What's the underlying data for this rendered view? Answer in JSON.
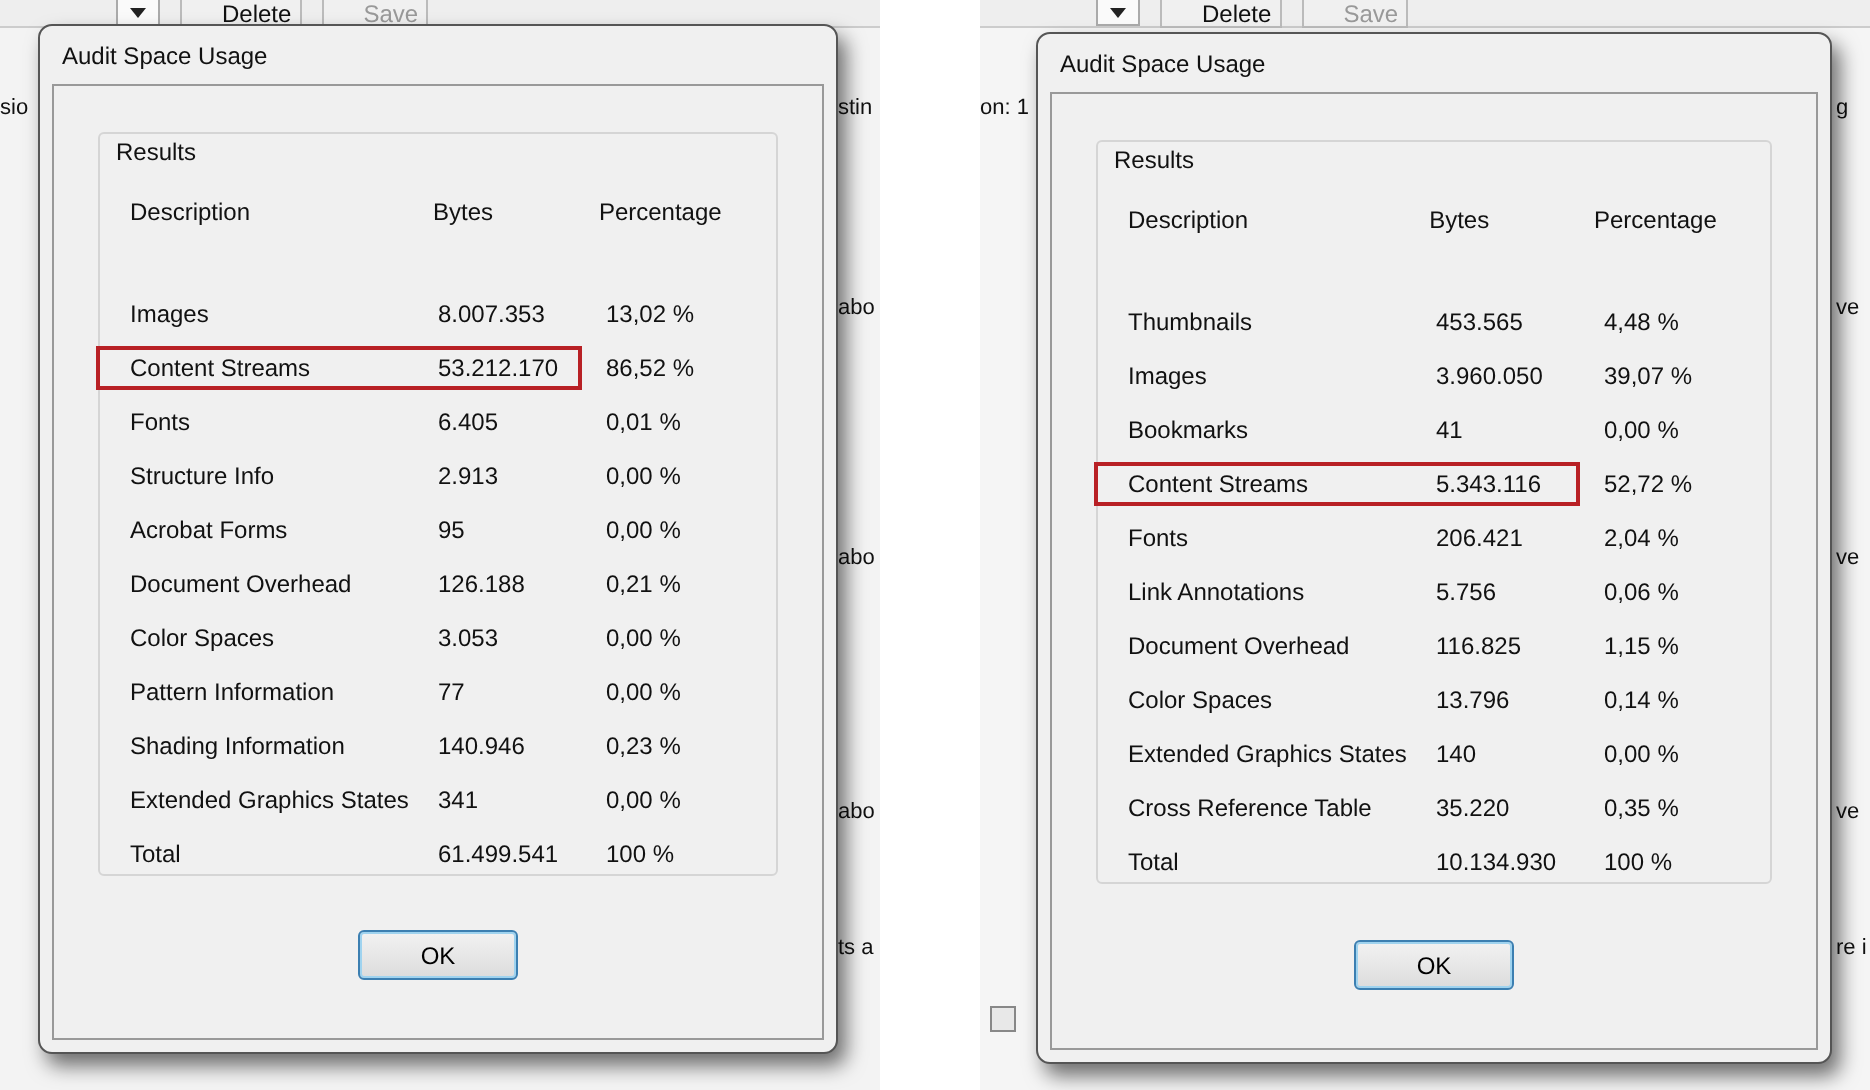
{
  "panels": [
    {
      "toolbar": [
        {
          "label": "Delete",
          "disabled": false
        },
        {
          "label": "Save",
          "disabled": true
        }
      ],
      "fragments": [
        "sio",
        "stin",
        "abo",
        "abo",
        "abo",
        "ts a"
      ],
      "dialog": {
        "title": "Audit Space Usage",
        "group_title": "Results",
        "columns": [
          "Description",
          "Bytes",
          "Percentage"
        ],
        "rows": [
          {
            "description": "Images",
            "bytes": "8.007.353",
            "percentage": "13,02 %",
            "highlighted": false
          },
          {
            "description": "Content Streams",
            "bytes": "53.212.170",
            "percentage": "86,52 %",
            "highlighted": true
          },
          {
            "description": "Fonts",
            "bytes": "6.405",
            "percentage": "0,01 %",
            "highlighted": false
          },
          {
            "description": "Structure Info",
            "bytes": "2.913",
            "percentage": "0,00 %",
            "highlighted": false
          },
          {
            "description": "Acrobat Forms",
            "bytes": "95",
            "percentage": "0,00 %",
            "highlighted": false
          },
          {
            "description": "Document Overhead",
            "bytes": "126.188",
            "percentage": "0,21 %",
            "highlighted": false
          },
          {
            "description": "Color Spaces",
            "bytes": "3.053",
            "percentage": "0,00 %",
            "highlighted": false
          },
          {
            "description": "Pattern Information",
            "bytes": "77",
            "percentage": "0,00 %",
            "highlighted": false
          },
          {
            "description": "Shading Information",
            "bytes": "140.946",
            "percentage": "0,23 %",
            "highlighted": false
          },
          {
            "description": "Extended Graphics States",
            "bytes": "341",
            "percentage": "0,00 %",
            "highlighted": false
          },
          {
            "description": "Total",
            "bytes": "61.499.541",
            "percentage": "100 %",
            "highlighted": false
          }
        ],
        "button": "OK"
      }
    },
    {
      "toolbar": [
        {
          "label": "Delete",
          "disabled": false
        },
        {
          "label": "Save",
          "disabled": true
        }
      ],
      "fragments": [
        "on: 1",
        "g",
        "ve",
        "ve",
        "ve",
        "re i"
      ],
      "checkbox": {
        "checked": false
      },
      "dialog": {
        "title": "Audit Space Usage",
        "group_title": "Results",
        "columns": [
          "Description",
          "Bytes",
          "Percentage"
        ],
        "rows": [
          {
            "description": "Thumbnails",
            "bytes": "453.565",
            "percentage": "4,48 %",
            "highlighted": false
          },
          {
            "description": "Images",
            "bytes": "3.960.050",
            "percentage": "39,07 %",
            "highlighted": false
          },
          {
            "description": "Bookmarks",
            "bytes": "41",
            "percentage": "0,00 %",
            "highlighted": false
          },
          {
            "description": "Content Streams",
            "bytes": "5.343.116",
            "percentage": "52,72 %",
            "highlighted": true
          },
          {
            "description": "Fonts",
            "bytes": "206.421",
            "percentage": "2,04 %",
            "highlighted": false
          },
          {
            "description": "Link Annotations",
            "bytes": "5.756",
            "percentage": "0,06 %",
            "highlighted": false
          },
          {
            "description": "Document Overhead",
            "bytes": "116.825",
            "percentage": "1,15 %",
            "highlighted": false
          },
          {
            "description": "Color Spaces",
            "bytes": "13.796",
            "percentage": "0,14 %",
            "highlighted": false
          },
          {
            "description": "Extended Graphics States",
            "bytes": "140",
            "percentage": "0,00 %",
            "highlighted": false
          },
          {
            "description": "Cross Reference Table",
            "bytes": "35.220",
            "percentage": "0,35 %",
            "highlighted": false
          },
          {
            "description": "Total",
            "bytes": "10.134.930",
            "percentage": "100 %",
            "highlighted": false
          }
        ],
        "button": "OK"
      }
    }
  ]
}
